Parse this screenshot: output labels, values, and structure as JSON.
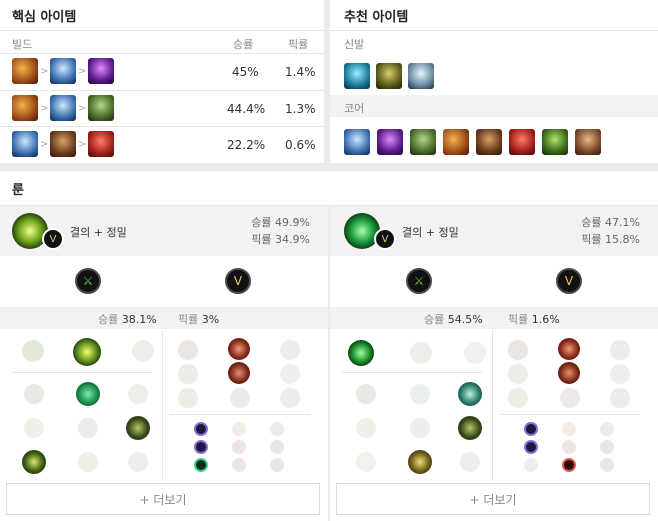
{
  "core_items": {
    "title": "핵심 아이템",
    "headers": {
      "build": "빌드",
      "winrate": "승률",
      "pickrate": "픽률"
    },
    "rows": [
      {
        "items": [
          "sword-item-icon",
          "boots-item-icon",
          "purple-item-icon"
        ],
        "winrate": "45%",
        "pickrate": "1.4%"
      },
      {
        "items": [
          "sword-item-icon",
          "boots-item-icon",
          "ghost-item-icon"
        ],
        "winrate": "44.4%",
        "pickrate": "1.3%"
      },
      {
        "items": [
          "boots-item-icon",
          "armor-item-icon",
          "red-item-icon"
        ],
        "winrate": "22.2%",
        "pickrate": "0.6%"
      }
    ]
  },
  "recommended_items": {
    "title": "추천 아이템",
    "boots_label": "신발",
    "boots": [
      "boots-blue-icon",
      "boots-green-icon",
      "boots-silver-icon"
    ],
    "core_label": "코어",
    "core": [
      "boots-item-icon",
      "purple-item-icon",
      "ghost-item-icon",
      "sword-item-icon",
      "armor-item-icon",
      "red-item-icon",
      "green-item-icon",
      "brown-item-icon"
    ]
  },
  "runes": {
    "title": "룬",
    "panels": [
      {
        "name": "결의 + 정밀",
        "winrate_label": "승률",
        "winrate": "49.9%",
        "pickrate_label": "픽률",
        "pickrate": "34.9%",
        "stat_winrate_label": "승률",
        "stat_winrate": "38.1%",
        "stat_pickrate_label": "픽률",
        "stat_pickrate": "3%",
        "more": "+ 더보기"
      },
      {
        "name": "결의 + 정밀",
        "winrate_label": "승률",
        "winrate": "47.1%",
        "pickrate_label": "픽률",
        "pickrate": "15.8%",
        "stat_winrate_label": "승률",
        "stat_winrate": "54.5%",
        "stat_pickrate_label": "픽률",
        "stat_pickrate": "1.6%",
        "more": "+ 더보기"
      }
    ]
  },
  "colors": {
    "accent_green": "#7ac33a",
    "text": "#333333",
    "muted": "#888888"
  }
}
